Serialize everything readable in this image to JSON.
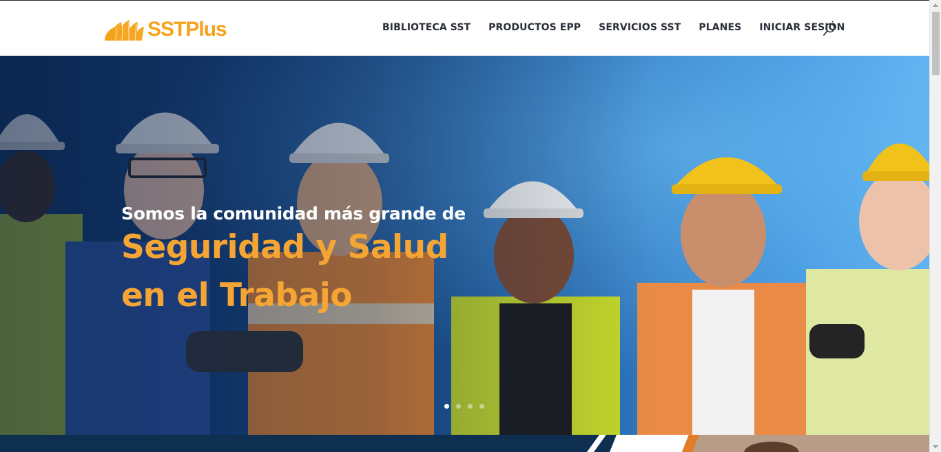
{
  "brand": {
    "name": "SSTPlus",
    "color": "#f6a21a"
  },
  "nav": {
    "items": [
      {
        "label": "BIBLIOTECA SST"
      },
      {
        "label": "PRODUCTOS EPP"
      },
      {
        "label": "SERVICIOS SST"
      },
      {
        "label": "PLANES"
      },
      {
        "label": "INICIAR SESIÓN"
      }
    ],
    "search_icon": "search-icon"
  },
  "hero": {
    "subtitle": "Somos la comunidad más grande de",
    "title_line1": "Seguridad y Salud",
    "title_line2": "en el Trabajo",
    "accent_color": "#f5a534",
    "slides": 4,
    "active_slide": 1
  }
}
